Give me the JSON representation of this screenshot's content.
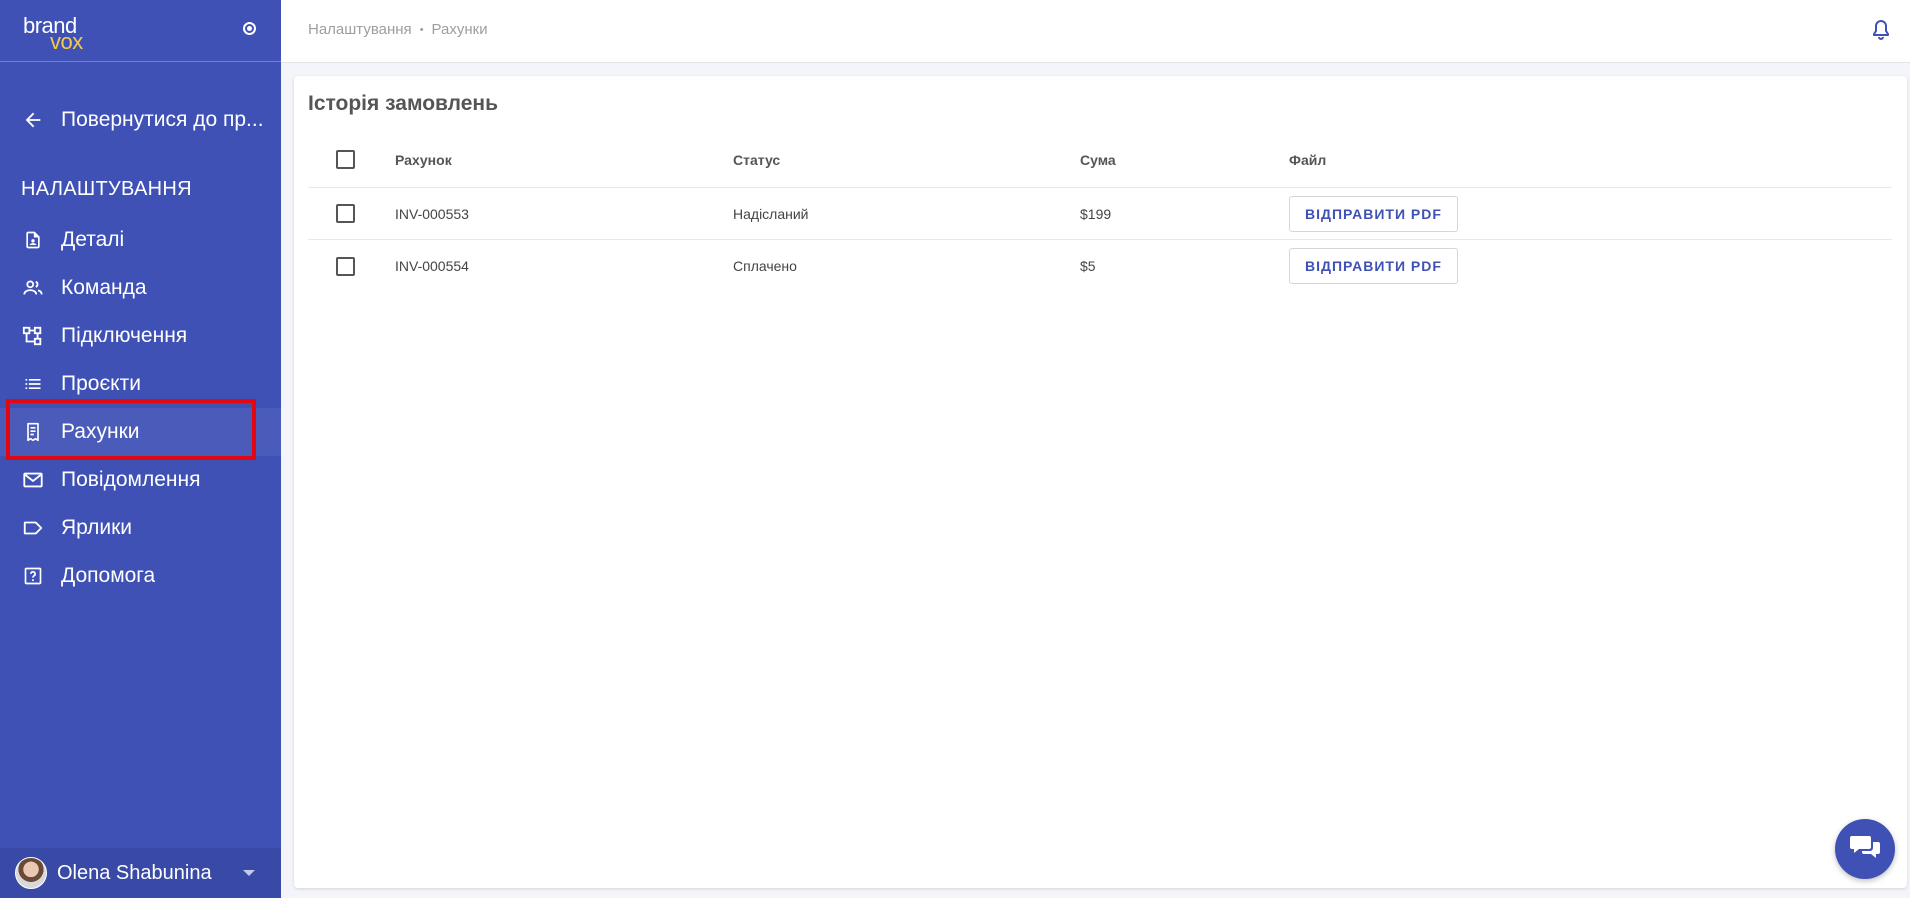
{
  "app": {
    "logo_top": "brand",
    "logo_bottom": "vox"
  },
  "sidebar": {
    "back_label": "Повернутися до пр...",
    "section_title": "НАЛАШТУВАННЯ",
    "items": [
      {
        "label": "Деталі",
        "icon": "document-icon"
      },
      {
        "label": "Команда",
        "icon": "team-icon"
      },
      {
        "label": "Підключення",
        "icon": "connections-icon"
      },
      {
        "label": "Проєкти",
        "icon": "list-icon"
      },
      {
        "label": "Рахунки",
        "icon": "receipt-icon",
        "active": true
      },
      {
        "label": "Повідомлення",
        "icon": "mail-icon"
      },
      {
        "label": "Ярлики",
        "icon": "label-icon"
      },
      {
        "label": "Допомога",
        "icon": "help-icon"
      }
    ],
    "user_name": "Olena Shabunina"
  },
  "header": {
    "breadcrumb_parent": "Налаштування",
    "breadcrumb_sep": "•",
    "breadcrumb_current": "Рахунки"
  },
  "main": {
    "title": "Історія замовлень",
    "columns": [
      "Рахунок",
      "Статус",
      "Сума",
      "Файл"
    ],
    "rows": [
      {
        "invoice": "INV-000553",
        "status": "Надісланий",
        "sum": "$199",
        "action": "ВІДПРАВИТИ PDF"
      },
      {
        "invoice": "INV-000554",
        "status": "Сплачено",
        "sum": "$5",
        "action": "ВІДПРАВИТИ PDF"
      }
    ]
  },
  "colors": {
    "sidebar_bg": "#3f51b5",
    "accent": "#3f51b5",
    "logo_accent": "#f3c94d",
    "highlight": "#e30613"
  }
}
